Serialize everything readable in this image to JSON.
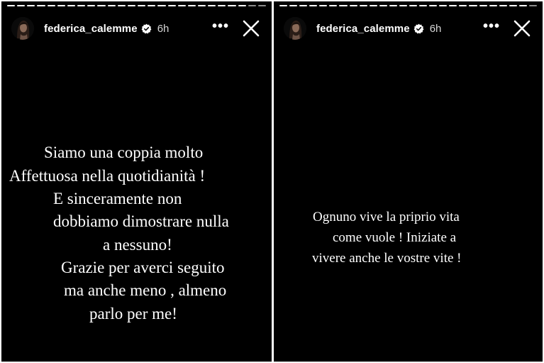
{
  "stories": [
    {
      "username": "federica_calemme",
      "time": "6h",
      "more_label": "•••",
      "icons": {
        "avatar": "profile-photo",
        "verified": "verified-badge-icon",
        "close": "close-icon"
      },
      "lines": [
        "Siamo una coppia molto",
        "Affettuosa nella quotidianità !",
        "E sinceramente non",
        "dobbiamo dimostrare nulla",
        "a nessuno!",
        "Grazie per averci seguito",
        "ma anche meno , almeno",
        "parlo per me!"
      ]
    },
    {
      "username": "federica_calemme",
      "time": "6h",
      "more_label": "•••",
      "icons": {
        "avatar": "profile-photo",
        "verified": "verified-badge-icon",
        "close": "close-icon"
      },
      "lines": [
        "Ognuno vive la priprio vita",
        "come vuole ! Iniziate a",
        "vivere anche le vostre vite !"
      ]
    }
  ],
  "colors": {
    "background": "#000000",
    "text": "#ffffff",
    "verified": "#ffffff"
  }
}
